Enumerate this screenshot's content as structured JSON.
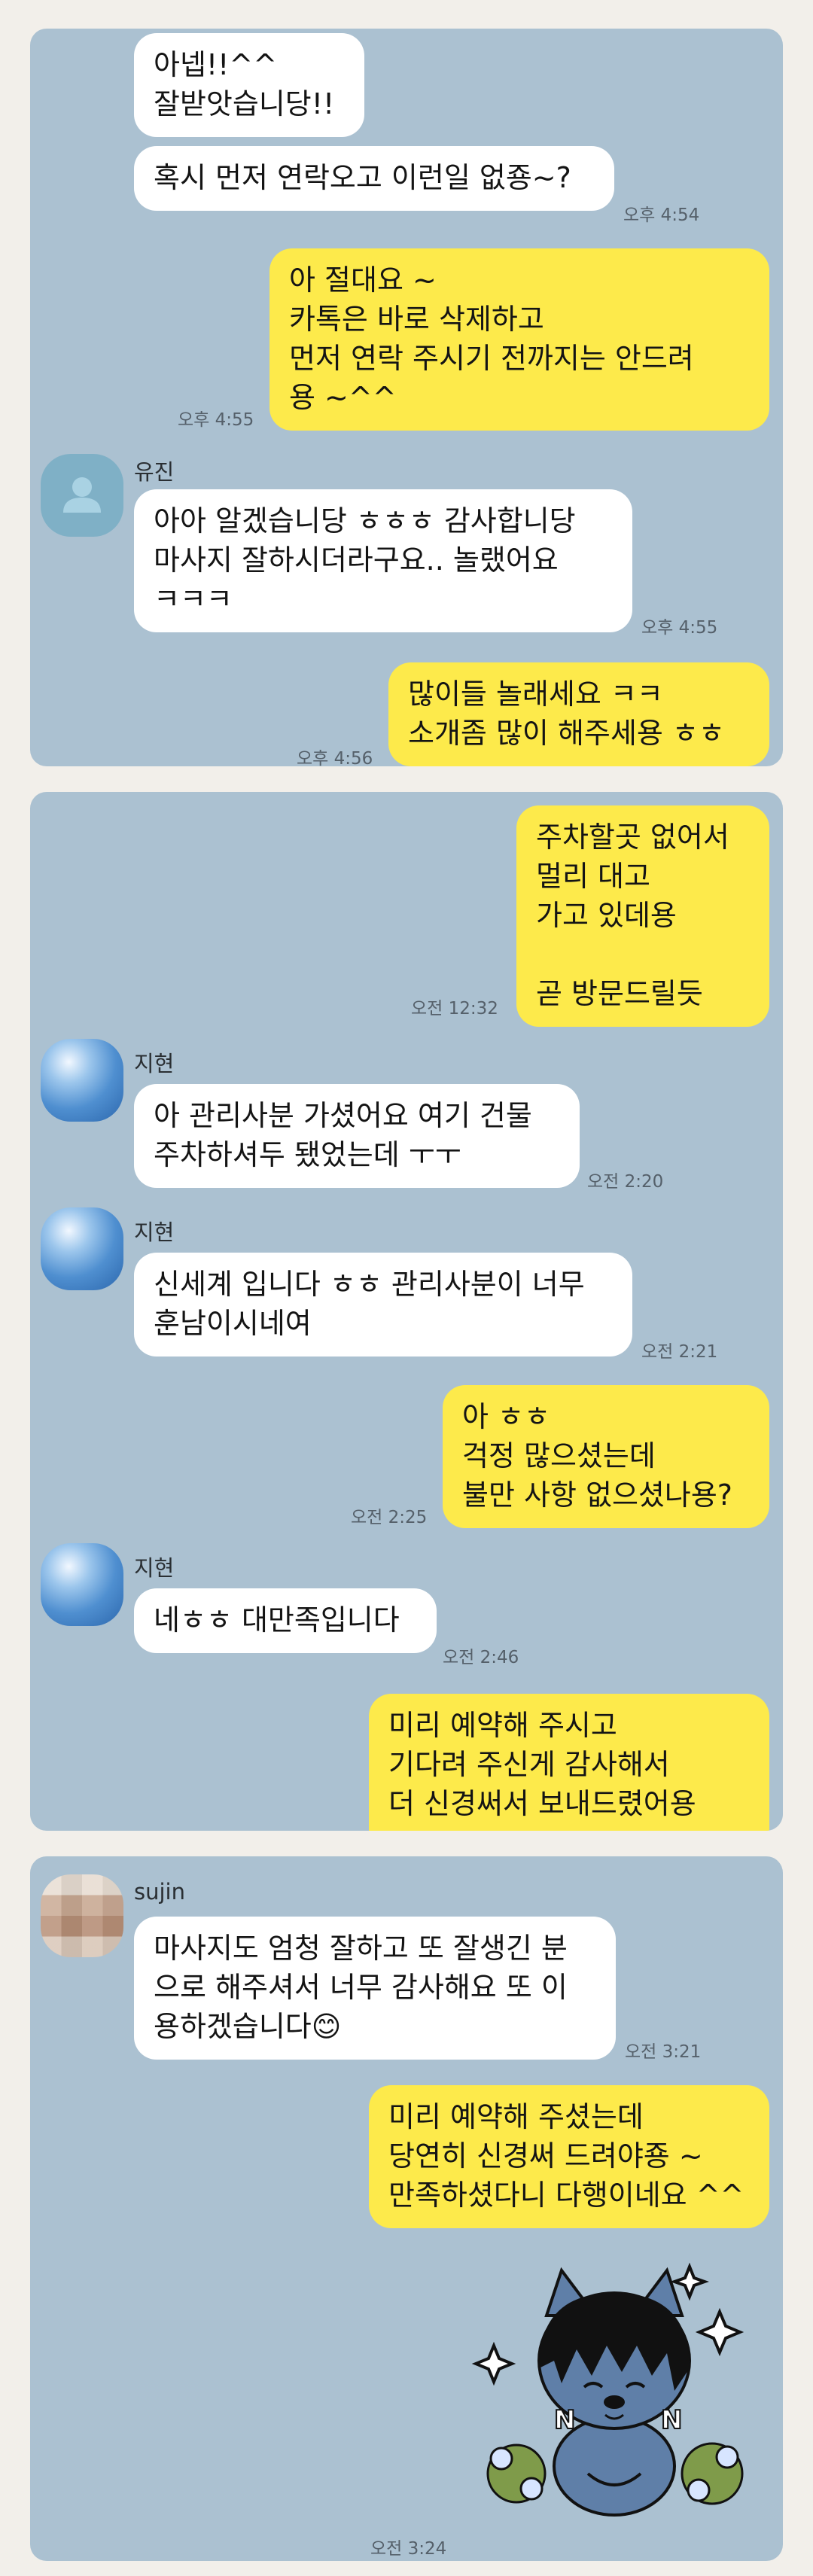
{
  "panel1": {
    "msg_1": "아넵!!^^\n잘받앗습니당!!",
    "msg_2": "혹시 먼저 연락오고 이런일 없죵~?",
    "time_2": "오후 4:54",
    "msg_3": "아 절대요 ~\n카톡은 바로 삭제하고\n먼저 연락 주시기 전까지는 안드려\n용 ~^^",
    "time_3": "오후 4:55",
    "sender_4": "유진",
    "msg_4": "아아 알겠습니당 ㅎㅎㅎ 감사합니당\n마사지 잘하시더라구요.. 놀랬어요\nㅋㅋㅋ",
    "time_4": "오후 4:55",
    "msg_5": "많이들 놀래세요 ㅋㅋ\n소개좀 많이 해주세용 ㅎㅎ",
    "time_5": "오후 4:56"
  },
  "panel2": {
    "msg_1": "주차할곳 없어서\n멀리 대고\n가고 있데용\n\n곧 방문드릴듯",
    "time_1": "오전 12:32",
    "sender_2": "지현",
    "msg_2": "아 관리사분 가셨어요 여기 건물\n주차하셔두 됐었는데 ㅜㅜ",
    "time_2": "오전 2:20",
    "sender_3": "지현",
    "msg_3": "신세계 입니다 ㅎㅎ 관리사분이 너무\n훈남이시네여",
    "time_3": "오전 2:21",
    "msg_4": "아 ㅎㅎ\n걱정 많으셨는데\n불만 사항 없으셨나용?",
    "time_4": "오전 2:25",
    "sender_5": "지현",
    "msg_5": "네ㅎㅎ 대만족입니다",
    "time_5": "오전 2:46",
    "msg_6": "미리 예약해 주시고\n기다려 주신게 감사해서\n더 신경써서 보내드렸어용 ^^"
  },
  "panel3": {
    "sender_1": "sujin",
    "msg_1": "마사지도 엄청 잘하고 또 잘생긴 분\n으로 해주셔서 너무 감사해요 또 이\n용하겠습니다",
    "emoji_1": "😊",
    "time_1": "오전 3:21",
    "msg_2": "미리 예약해 주셨는데\n당연히 신경써 드려야죵 ~\n만족하셨다니 다행이네요 ^^",
    "time_2": "오전 3:24"
  },
  "icons": {
    "default_avatar": "person-silhouette-icon",
    "sticker": "cat-character-sticker"
  },
  "colors": {
    "chat_background": "#abc1d1",
    "incoming_bubble": "#ffffff",
    "outgoing_bubble": "#fdea4b",
    "page_background": "#f2efea"
  }
}
